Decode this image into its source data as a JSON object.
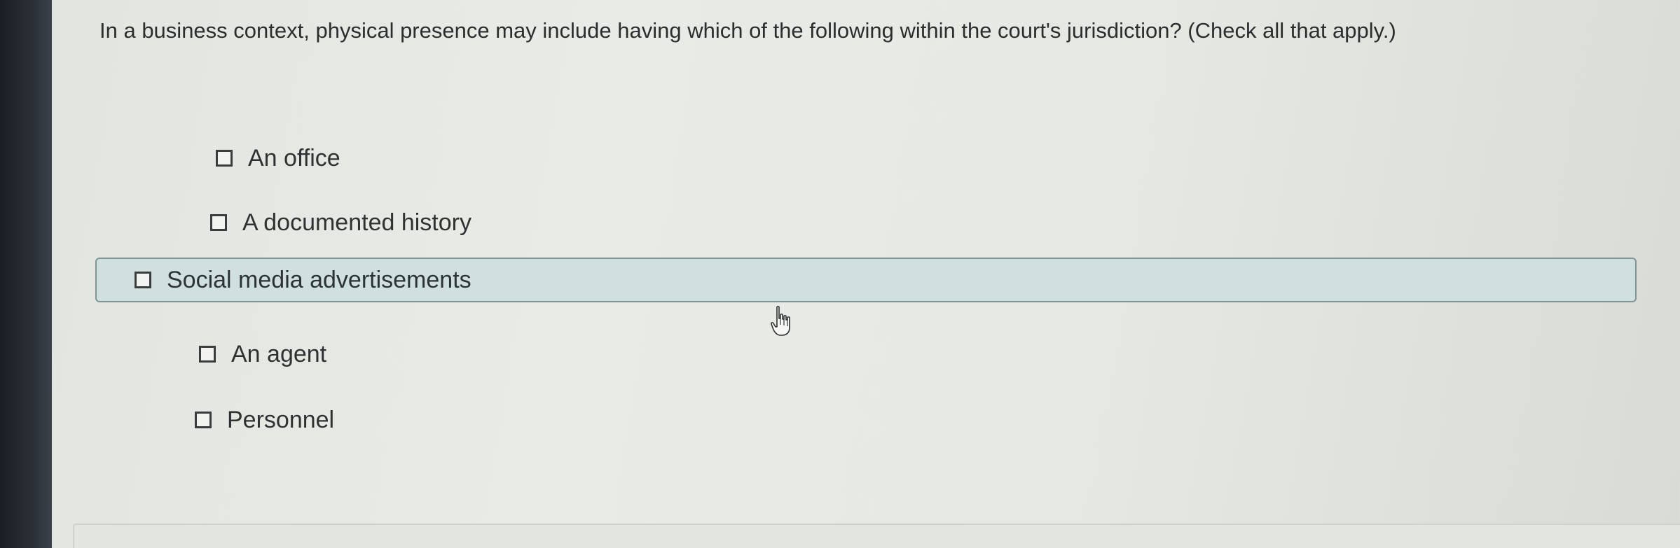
{
  "question": {
    "text": "In a business context, physical presence may include having which of the following within the court's jurisdiction? (Check all that apply.)"
  },
  "options": [
    {
      "label": "An office",
      "checked": false
    },
    {
      "label": "A documented history",
      "checked": false
    },
    {
      "label": "Social media advertisements",
      "checked": false,
      "hovered": true
    },
    {
      "label": "An agent",
      "checked": false
    },
    {
      "label": "Personnel",
      "checked": false
    }
  ],
  "colors": {
    "hover_fill": "#cfe0de",
    "hover_border": "#7f9596",
    "text": "#2b2e30"
  },
  "cursor": {
    "icon": "hand-pointer-icon"
  }
}
